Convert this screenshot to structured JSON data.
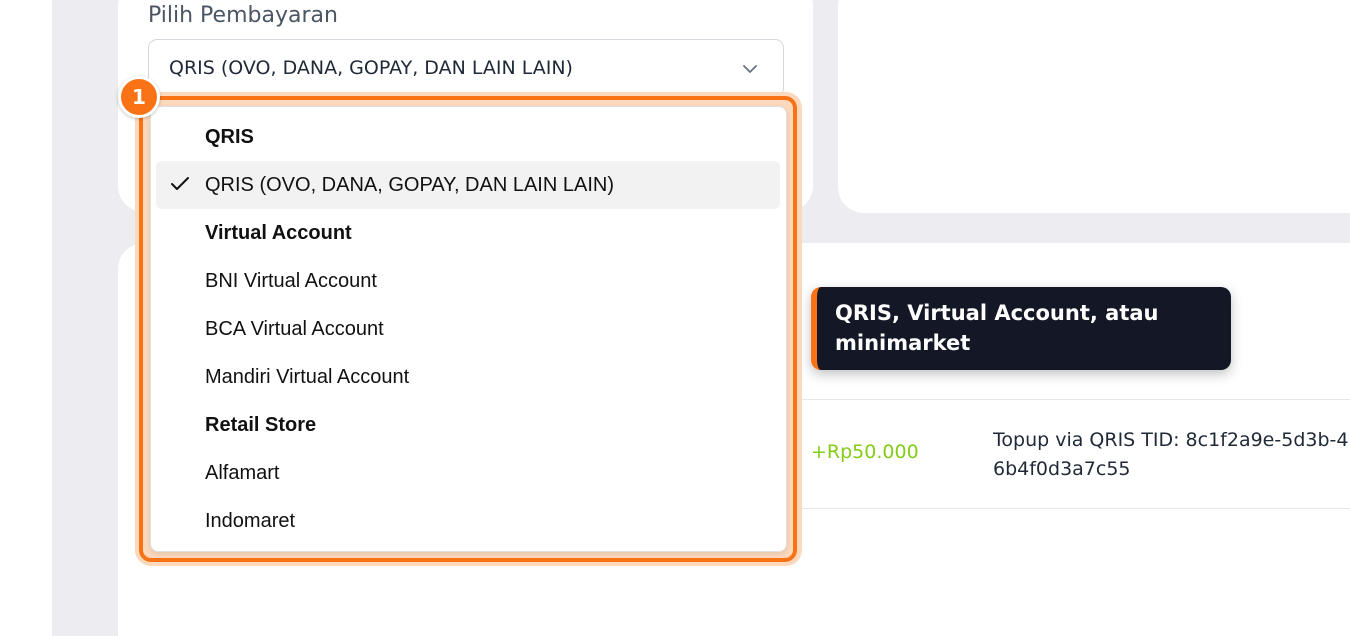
{
  "form": {
    "label": "Pilih Pembayaran",
    "selected_value": "QRIS (OVO, DANA, GOPAY, DAN LAIN LAIN)"
  },
  "dropdown": {
    "options": [
      {
        "label": "QRIS",
        "type": "group"
      },
      {
        "label": "QRIS (OVO, DANA, GOPAY, DAN LAIN LAIN)",
        "type": "option",
        "selected": true
      },
      {
        "label": "Virtual Account",
        "type": "group"
      },
      {
        "label": "BNI Virtual Account",
        "type": "option"
      },
      {
        "label": "BCA Virtual Account",
        "type": "option"
      },
      {
        "label": "Mandiri Virtual Account",
        "type": "option"
      },
      {
        "label": "Retail Store",
        "type": "group"
      },
      {
        "label": "Alfamart",
        "type": "option"
      },
      {
        "label": "Indomaret",
        "type": "option"
      }
    ]
  },
  "annotation": {
    "step_number": "1",
    "tooltip_text": "QRIS, Virtual Account, atau minimarket"
  },
  "transaction": {
    "amount": "+Rp50.000",
    "description_line1": "Topup via QRIS TID: 8c1f2a9e-5d3b-4",
    "description_line2": "6b4f0d3a7c55"
  },
  "colors": {
    "accent": "#f97316",
    "amount_positive": "#84cc16",
    "tooltip_bg": "#141826"
  },
  "icons": {
    "select_chevron": "chevron-down-icon",
    "selected_check": "check-icon"
  }
}
